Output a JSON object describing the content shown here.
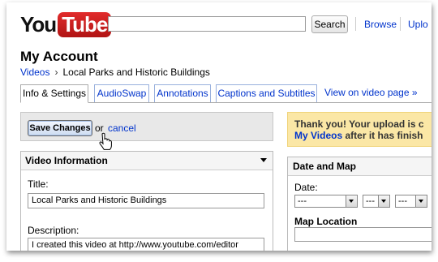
{
  "header": {
    "logo_you": "You",
    "logo_tube": "Tube",
    "search_value": "",
    "search_button": "Search",
    "links": [
      "Browse",
      "Uplo"
    ]
  },
  "page": {
    "title": "My Account",
    "breadcrumb": {
      "parent": "Videos",
      "separator": "›",
      "current": "Local Parks and Historic Buildings"
    }
  },
  "tabs": [
    {
      "label": "Info & Settings",
      "active": true
    },
    {
      "label": "AudioSwap",
      "active": false
    },
    {
      "label": "Annotations",
      "active": false
    },
    {
      "label": "Captions and Subtitles",
      "active": false
    }
  ],
  "view_link": "View on video page »",
  "save_bar": {
    "save_label": "Save Changes",
    "or_text": "or",
    "cancel_label": "cancel"
  },
  "video_info": {
    "header": "Video Information",
    "title_label": "Title:",
    "title_value": "Local Parks and Historic Buildings",
    "description_label": "Description:",
    "description_value": "I created this video at http://www.youtube.com/editor"
  },
  "notice": {
    "line1": "Thank you! Your upload is c",
    "line2_link": "My Videos",
    "line2_rest": " after it has finish"
  },
  "date_map": {
    "header": "Date and Map",
    "date_label": "Date:",
    "month_value": "---",
    "day_value": "---",
    "year_value": "---",
    "map_label": "Map Location"
  },
  "colors": {
    "link": "#0033cc",
    "notice_bg": "#fbe7a6",
    "logo_red": "#cc1e1e"
  }
}
